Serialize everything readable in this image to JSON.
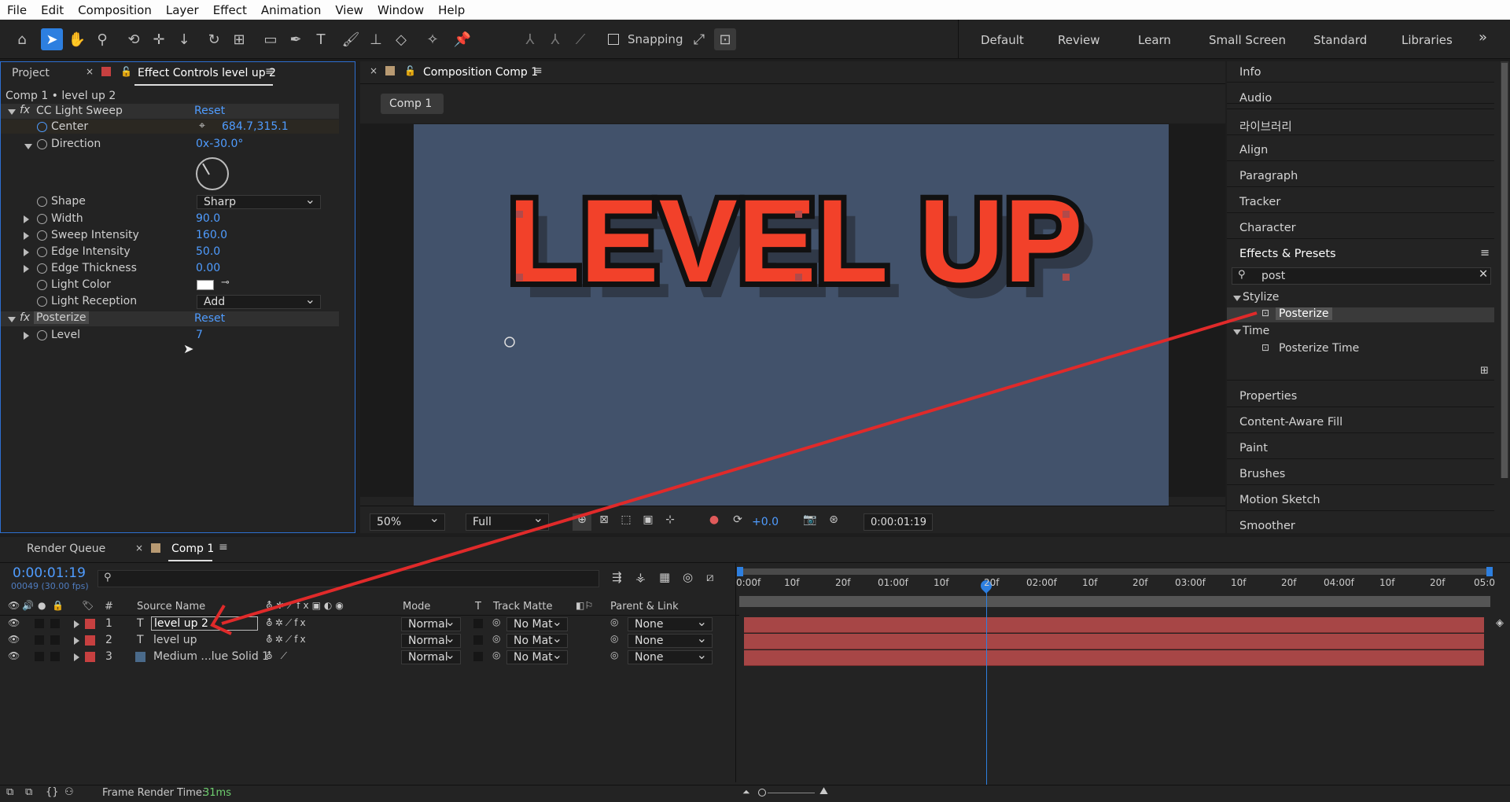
{
  "menu": [
    "File",
    "Edit",
    "Composition",
    "Layer",
    "Effect",
    "Animation",
    "View",
    "Window",
    "Help"
  ],
  "toolbar": {
    "snapping_label": "Snapping",
    "workspaces": [
      "Default",
      "Review",
      "Learn",
      "Small Screen",
      "Standard",
      "Libraries"
    ],
    "more": "»"
  },
  "left_panel": {
    "tab_project": "Project",
    "tab_effect": "Effect Controls level up 2",
    "layer_path": "Comp 1 • level up 2",
    "effects": [
      {
        "name": "CC Light Sweep",
        "reset": "Reset",
        "props": [
          {
            "label": "Center",
            "value": "684.7,315.1"
          },
          {
            "label": "Direction",
            "value": "0x-30.0°"
          },
          {
            "label": "Shape",
            "value": "Sharp"
          },
          {
            "label": "Width",
            "value": "90.0"
          },
          {
            "label": "Sweep Intensity",
            "value": "160.0"
          },
          {
            "label": "Edge Intensity",
            "value": "50.0"
          },
          {
            "label": "Edge Thickness",
            "value": "0.00"
          },
          {
            "label": "Light Color",
            "value": ""
          },
          {
            "label": "Light Reception",
            "value": "Add"
          }
        ]
      },
      {
        "name": "Posterize",
        "reset": "Reset",
        "props": [
          {
            "label": "Level",
            "value": "7"
          }
        ]
      }
    ]
  },
  "comp_panel": {
    "tab": "Composition Comp 1",
    "crumb": "Comp 1",
    "canvas_text": "LEVEL UP",
    "zoom": "50%",
    "resolution": "Full",
    "exposure": "+0.0",
    "timecode": "0:00:01:19"
  },
  "right_panel": {
    "items_top": [
      "Info",
      "Audio",
      "라이브러리",
      "Align",
      "Paragraph",
      "Tracker",
      "Character"
    ],
    "effects_title": "Effects & Presets",
    "search": "post",
    "tree": [
      {
        "group": "Stylize",
        "item": "Posterize"
      },
      {
        "group": "Time",
        "item": "Posterize Time"
      }
    ],
    "items_bottom": [
      "Properties",
      "Content-Aware Fill",
      "Paint",
      "Brushes",
      "Motion Sketch",
      "Smoother"
    ]
  },
  "timeline": {
    "tab_render": "Render Queue",
    "tab_comp": "Comp 1",
    "timecode": "0:00:01:19",
    "frames": "00049 (30.00 fps)",
    "headers": {
      "num": "#",
      "source": "Source Name",
      "mode": "Mode",
      "t": "T",
      "track": "Track Matte",
      "parent": "Parent & Link"
    },
    "layers": [
      {
        "num": "1",
        "type": "T",
        "name": "level up 2",
        "mode": "Normal",
        "matte": "No Mat",
        "parent": "None"
      },
      {
        "num": "2",
        "type": "T",
        "name": "level up",
        "mode": "Normal",
        "matte": "No Mat",
        "parent": "None"
      },
      {
        "num": "3",
        "type": "",
        "name": "Medium ...lue Solid 1",
        "mode": "Normal",
        "matte": "No Mat",
        "parent": "None"
      }
    ],
    "ruler": [
      "0:00f",
      "10f",
      "20f",
      "01:00f",
      "10f",
      "20f",
      "02:00f",
      "10f",
      "20f",
      "03:00f",
      "10f",
      "20f",
      "04:00f",
      "10f",
      "20f",
      "05:0"
    ],
    "footer_label": "Frame Render Time:",
    "footer_value": "31ms"
  },
  "colors": {
    "accent": "#2d7fe0",
    "text_red": "#f2412a",
    "canvas_bg": "#42526b",
    "layer_bar": "#a74646",
    "arrow": "#e02a2a"
  }
}
